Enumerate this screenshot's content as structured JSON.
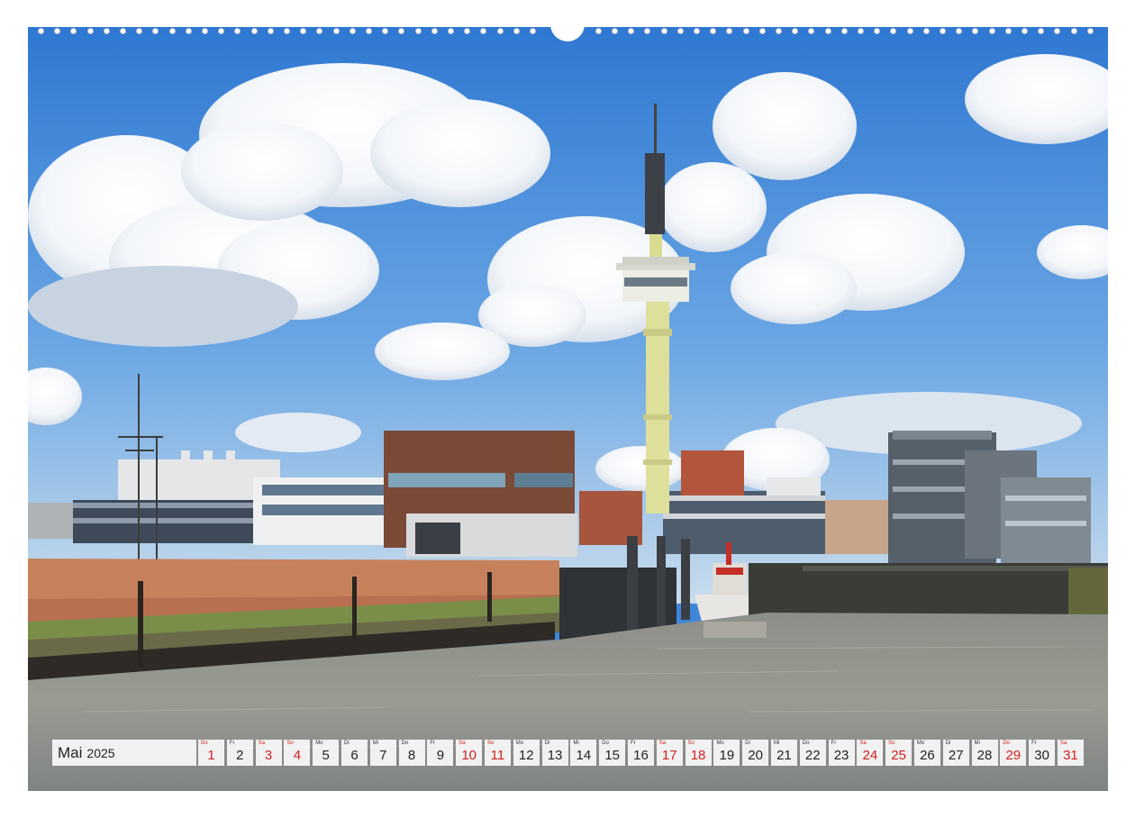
{
  "calendar": {
    "month": "Mai",
    "year": "2025",
    "weekend_color": "#d21f1f",
    "days": [
      {
        "wd": "Do",
        "num": "1",
        "weekend": true
      },
      {
        "wd": "Fr",
        "num": "2",
        "weekend": false
      },
      {
        "wd": "Sa",
        "num": "3",
        "weekend": true
      },
      {
        "wd": "So",
        "num": "4",
        "weekend": true
      },
      {
        "wd": "Mo",
        "num": "5",
        "weekend": false
      },
      {
        "wd": "Di",
        "num": "6",
        "weekend": false
      },
      {
        "wd": "Mi",
        "num": "7",
        "weekend": false
      },
      {
        "wd": "Do",
        "num": "8",
        "weekend": false
      },
      {
        "wd": "Fr",
        "num": "9",
        "weekend": false
      },
      {
        "wd": "Sa",
        "num": "10",
        "weekend": true
      },
      {
        "wd": "So",
        "num": "11",
        "weekend": true
      },
      {
        "wd": "Mo",
        "num": "12",
        "weekend": false
      },
      {
        "wd": "Di",
        "num": "13",
        "weekend": false
      },
      {
        "wd": "Mi",
        "num": "14",
        "weekend": false
      },
      {
        "wd": "Do",
        "num": "15",
        "weekend": false
      },
      {
        "wd": "Fr",
        "num": "16",
        "weekend": false
      },
      {
        "wd": "Sa",
        "num": "17",
        "weekend": true
      },
      {
        "wd": "So",
        "num": "18",
        "weekend": true
      },
      {
        "wd": "Mo",
        "num": "19",
        "weekend": false
      },
      {
        "wd": "Di",
        "num": "20",
        "weekend": false
      },
      {
        "wd": "Mi",
        "num": "21",
        "weekend": false
      },
      {
        "wd": "Do",
        "num": "22",
        "weekend": false
      },
      {
        "wd": "Fr",
        "num": "23",
        "weekend": false
      },
      {
        "wd": "Sa",
        "num": "24",
        "weekend": true
      },
      {
        "wd": "So",
        "num": "25",
        "weekend": true
      },
      {
        "wd": "Mo",
        "num": "26",
        "weekend": false
      },
      {
        "wd": "Di",
        "num": "27",
        "weekend": false
      },
      {
        "wd": "Mi",
        "num": "28",
        "weekend": false
      },
      {
        "wd": "Do",
        "num": "29",
        "weekend": true
      },
      {
        "wd": "Fr",
        "num": "30",
        "weekend": false
      },
      {
        "wd": "Sa",
        "num": "31",
        "weekend": true
      }
    ]
  },
  "photo": {
    "subject": "harbour with radar tower",
    "sky_color": "#3f86d9",
    "water_color": "#8f9390"
  }
}
